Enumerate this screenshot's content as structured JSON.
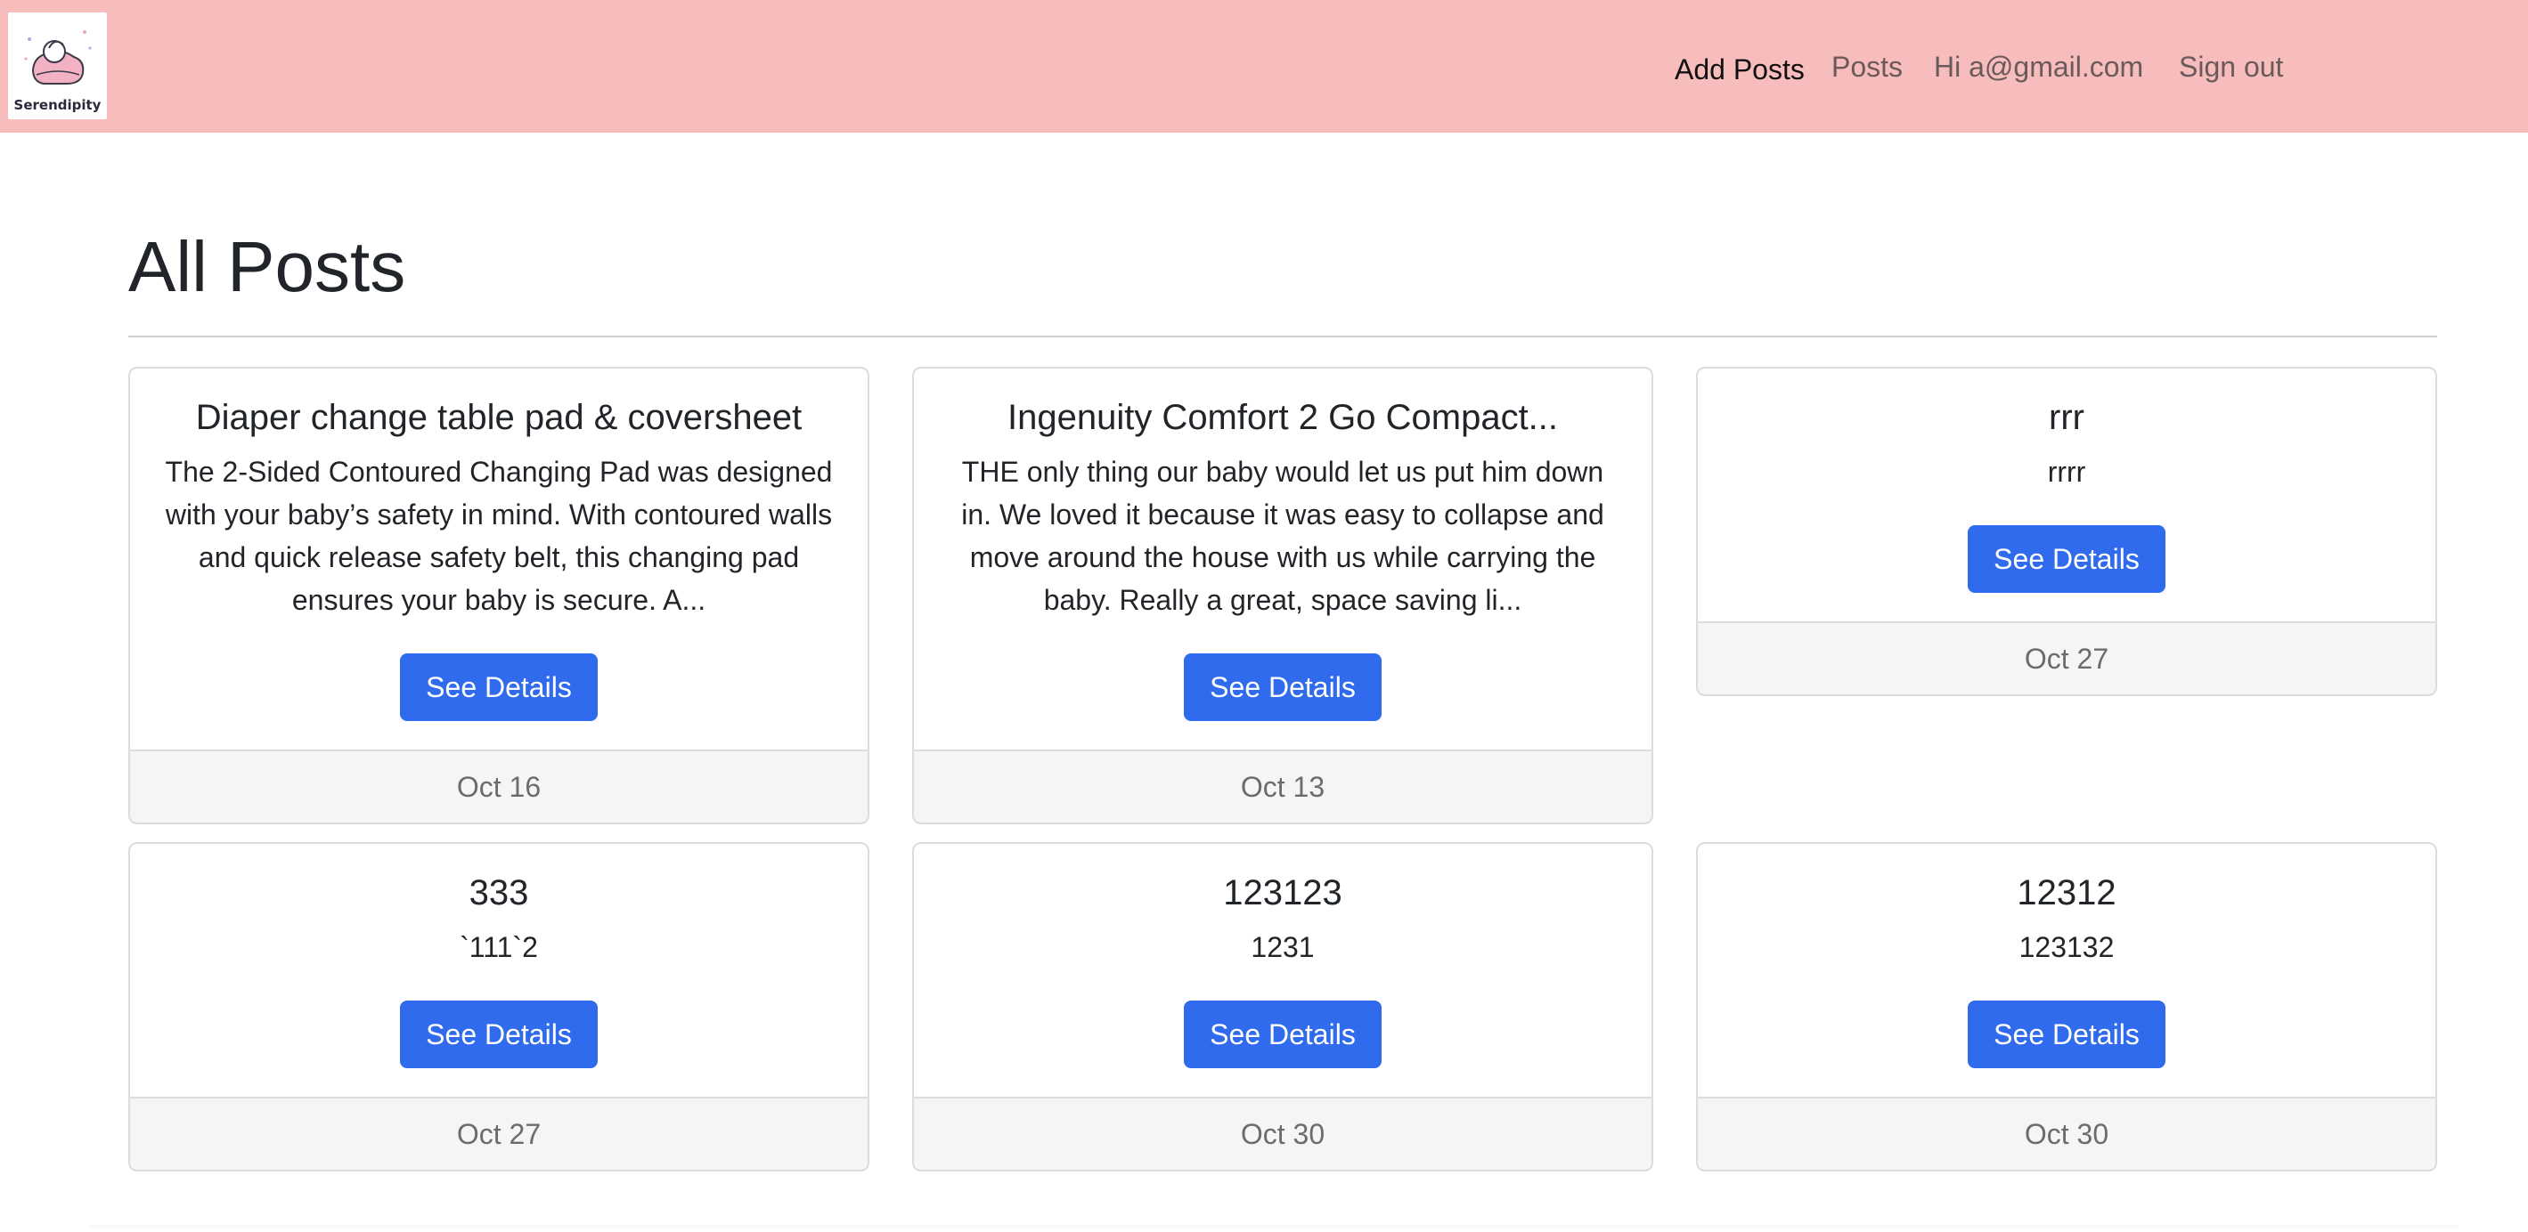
{
  "app": {
    "logo_text": "Serendipity"
  },
  "nav": {
    "add_posts": "Add Posts",
    "posts": "Posts",
    "greeting": "Hi a@gmail.com",
    "sign_out": "Sign out"
  },
  "page": {
    "title": "All Posts"
  },
  "posts": [
    {
      "title": "Diaper change table pad & coversheet",
      "text": "The 2-Sided Contoured Changing Pad was designed with your baby’s safety in mind. With contoured walls and quick release safety belt, this changing pad ensures your baby is secure. A...",
      "button": "See Details",
      "date": "Oct 16"
    },
    {
      "title": "Ingenuity Comfort 2 Go Compact...",
      "text": "THE only thing our baby would let us put him down in. We loved it because it was easy to collapse and move around the house with us while carrying the baby. Really a great, space saving li...",
      "button": "See Details",
      "date": "Oct 13"
    },
    {
      "title": "rrr",
      "text": "rrrr",
      "button": "See Details",
      "date": "Oct 27"
    },
    {
      "title": "333",
      "text": "`111`2",
      "button": "See Details",
      "date": "Oct 27"
    },
    {
      "title": "123123",
      "text": "1231",
      "button": "See Details",
      "date": "Oct 30"
    },
    {
      "title": "12312",
      "text": "123132",
      "button": "See Details",
      "date": "Oct 30"
    }
  ],
  "colors": {
    "navbar": "#f7bcbc",
    "button": "#2f6bec",
    "footer": "#f5f5f5"
  }
}
